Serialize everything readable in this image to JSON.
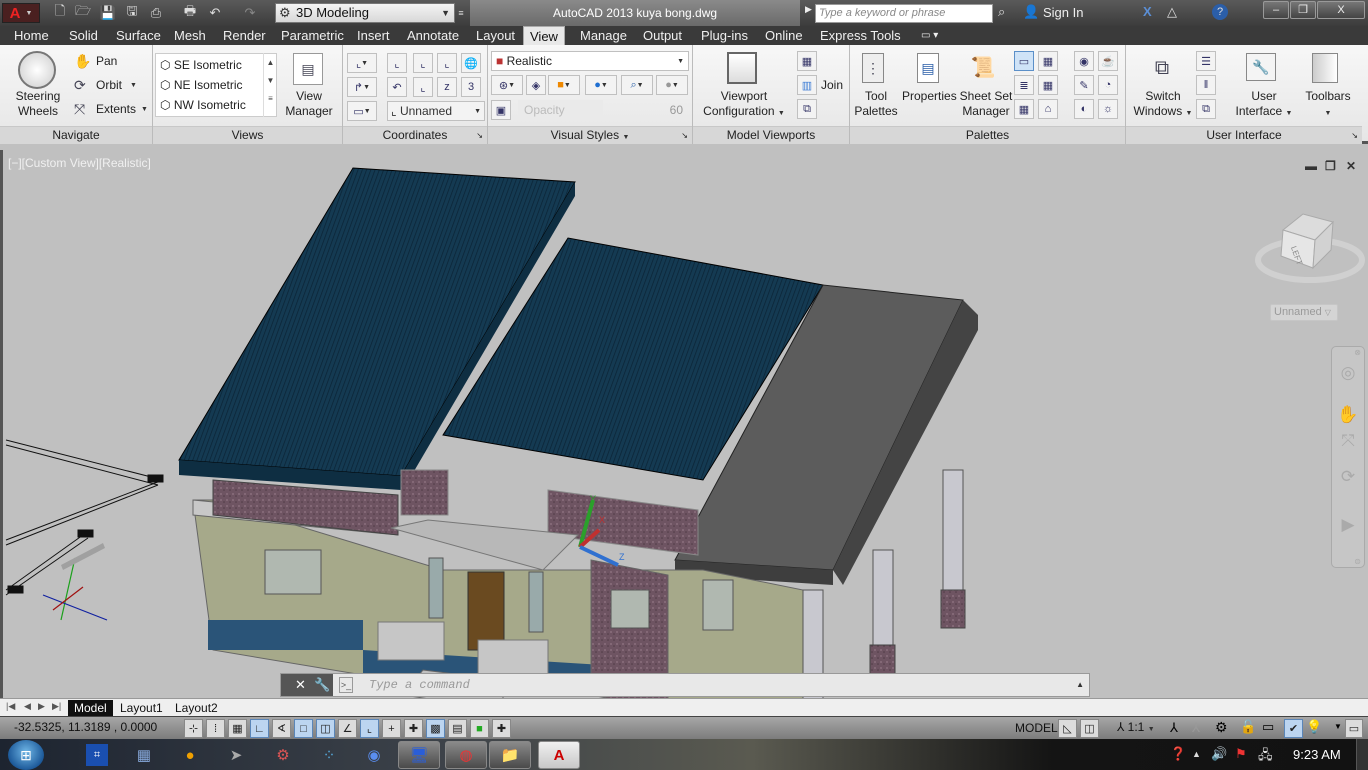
{
  "titlebar": {
    "workspace": "3D Modeling",
    "app_title": "AutoCAD 2013    kuya bong.dwg",
    "search_placeholder": "Type a keyword or phrase",
    "sign_in": "Sign In",
    "win_minimize": "–",
    "win_restore": "❐",
    "win_close": "X"
  },
  "menu_tabs": [
    "Home",
    "Solid",
    "Surface",
    "Mesh",
    "Render",
    "Parametric",
    "Insert",
    "Annotate",
    "Layout",
    "View",
    "Manage",
    "Output",
    "Plug-ins",
    "Online",
    "Express Tools"
  ],
  "active_tab": "View",
  "ribbon": {
    "navigate": {
      "title": "Navigate",
      "steering_wheels": "Steering\nWheels",
      "steering_l1": "Steering",
      "steering_l2": "Wheels",
      "pan": "Pan",
      "orbit": "Orbit",
      "extents": "Extents"
    },
    "views": {
      "title": "Views",
      "items": [
        "SE Isometric",
        "NE Isometric",
        "NW Isometric"
      ],
      "view_manager_l1": "View",
      "view_manager_l2": "Manager"
    },
    "coordinates": {
      "title": "Coordinates",
      "ucs_name": "Unnamed"
    },
    "visual_styles": {
      "title": "Visual Styles",
      "current": "Realistic",
      "opacity_label": "Opacity",
      "opacity_value": "60"
    },
    "model_viewports": {
      "title": "Model Viewports",
      "viewport_config_l1": "Viewport",
      "viewport_config_l2": "Configuration",
      "join": "Join"
    },
    "palettes": {
      "title": "Palettes",
      "tool_palettes_l1": "Tool",
      "tool_palettes_l2": "Palettes",
      "properties": "Properties",
      "sheet_set_l1": "Sheet Set",
      "sheet_set_l2": "Manager"
    },
    "user_interface": {
      "title": "User Interface",
      "switch_windows_l1": "Switch",
      "switch_windows_l2": "Windows",
      "user_interface_l1": "User",
      "user_interface_l2": "Interface",
      "toolbars": "Toolbars"
    }
  },
  "viewport": {
    "label": "[−][Custom View][Realistic]",
    "viewcube_face": "LEFT",
    "viewcube_ucs": "Unnamed",
    "ucs_axes": {
      "x": "X",
      "y": "Y",
      "z": "Z"
    }
  },
  "command_line": {
    "placeholder": "Type a command"
  },
  "layout_tabs": [
    "Model",
    "Layout1",
    "Layout2"
  ],
  "active_layout": "Model",
  "status": {
    "coordinates": "-32.5325, 11.3189 , 0.0000",
    "model": "MODEL",
    "annotation_scale": "1:1"
  },
  "taskbar": {
    "clock": "9:23 AM"
  }
}
